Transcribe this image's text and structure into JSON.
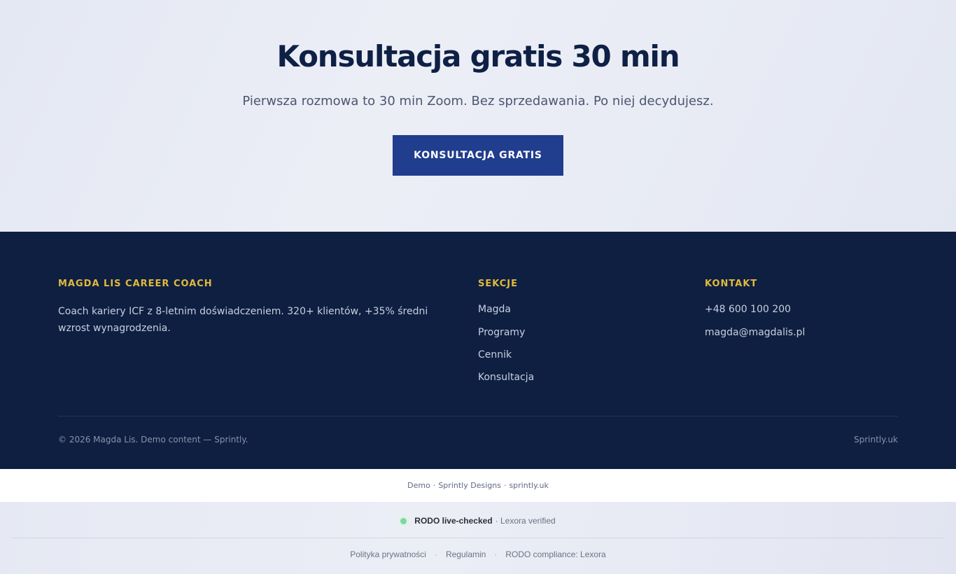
{
  "cta": {
    "title": "Konsultacja gratis 30 min",
    "subtitle": "Pierwsza rozmowa to 30 min Zoom. Bez sprzedawania. Po niej decydujesz.",
    "button_label": "KONSULTACJA GRATIS"
  },
  "footer": {
    "brand_heading": "MAGDA LIS CAREER COACH",
    "about": "Coach kariery ICF z 8-letnim doświadczeniem. 320+ klientów, +35% średni wzrost wynagrodzenia.",
    "sections_heading": "SEKCJE",
    "sections": [
      "Magda",
      "Programy",
      "Cennik",
      "Konsultacja"
    ],
    "contact_heading": "KONTAKT",
    "phone": "+48 600 100 200",
    "email": "magda@magdalis.pl",
    "copyright": "© 2026 Magda Lis. Demo content — Sprintly.",
    "credit_link": "Sprintly.uk"
  },
  "demo_bar": {
    "demo": "Demo",
    "separator": "·",
    "designs": "Sprintly Designs",
    "site": "sprintly.uk"
  },
  "compliance": {
    "status_bold": "RODO live-checked",
    "status_rest": "· Lexora verified",
    "links": [
      "Polityka prywatności",
      "Regulamin",
      "RODO compliance: Lexora"
    ],
    "separator": "·"
  },
  "colors": {
    "navy": "#0e1f42",
    "button_blue": "#213d8e",
    "accent_gold": "#e2b93b",
    "status_green": "#7ed6a0"
  }
}
